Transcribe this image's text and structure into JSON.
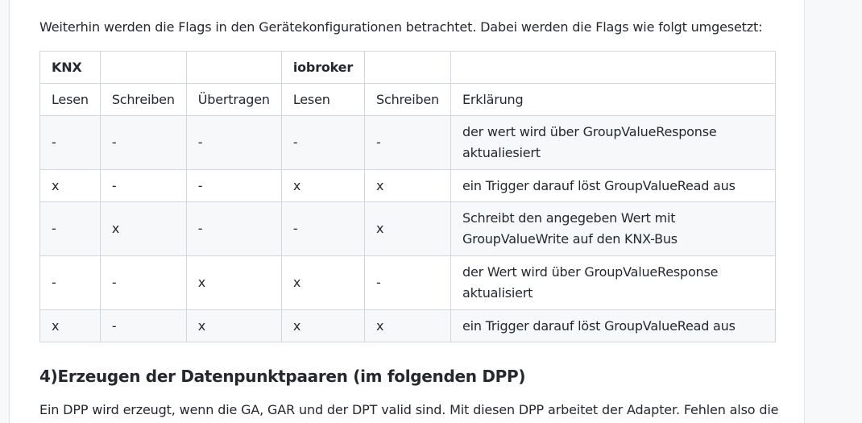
{
  "intro": "Weiterhin werden die Flags in den Gerätekonfigurationen betrachtet. Dabei werden die Flags wie folgt umgesetzt:",
  "table": {
    "group_headers": [
      "KNX",
      "",
      "",
      "iobroker",
      "",
      ""
    ],
    "columns": [
      "Lesen",
      "Schreiben",
      "Übertragen",
      "Lesen",
      "Schreiben",
      "Erklärung"
    ],
    "rows": [
      [
        "-",
        "-",
        "-",
        "-",
        "-",
        "der wert wird über GroupValueResponse aktualiesiert"
      ],
      [
        "x",
        "-",
        "-",
        "x",
        "x",
        "ein Trigger darauf löst GroupValueRead aus"
      ],
      [
        "-",
        "x",
        "-",
        "-",
        "x",
        "Schreibt den angegeben Wert mit GroupValueWrite auf den KNX-Bus"
      ],
      [
        "-",
        "-",
        "x",
        "x",
        "-",
        "der Wert wird über GroupValueResponse aktualisiert"
      ],
      [
        "x",
        "-",
        "x",
        "x",
        "x",
        "ein Trigger darauf löst GroupValueRead aus"
      ]
    ]
  },
  "section_heading": "4)Erzeugen der Datenpunktpaaren (im folgenden DPP)",
  "paragraph": "Ein DPP wird erzeugt, wenn die GA, GAR und der DPT valid sind. Mit diesen DPP arbeitet der Adapter. Fehlen also die"
}
